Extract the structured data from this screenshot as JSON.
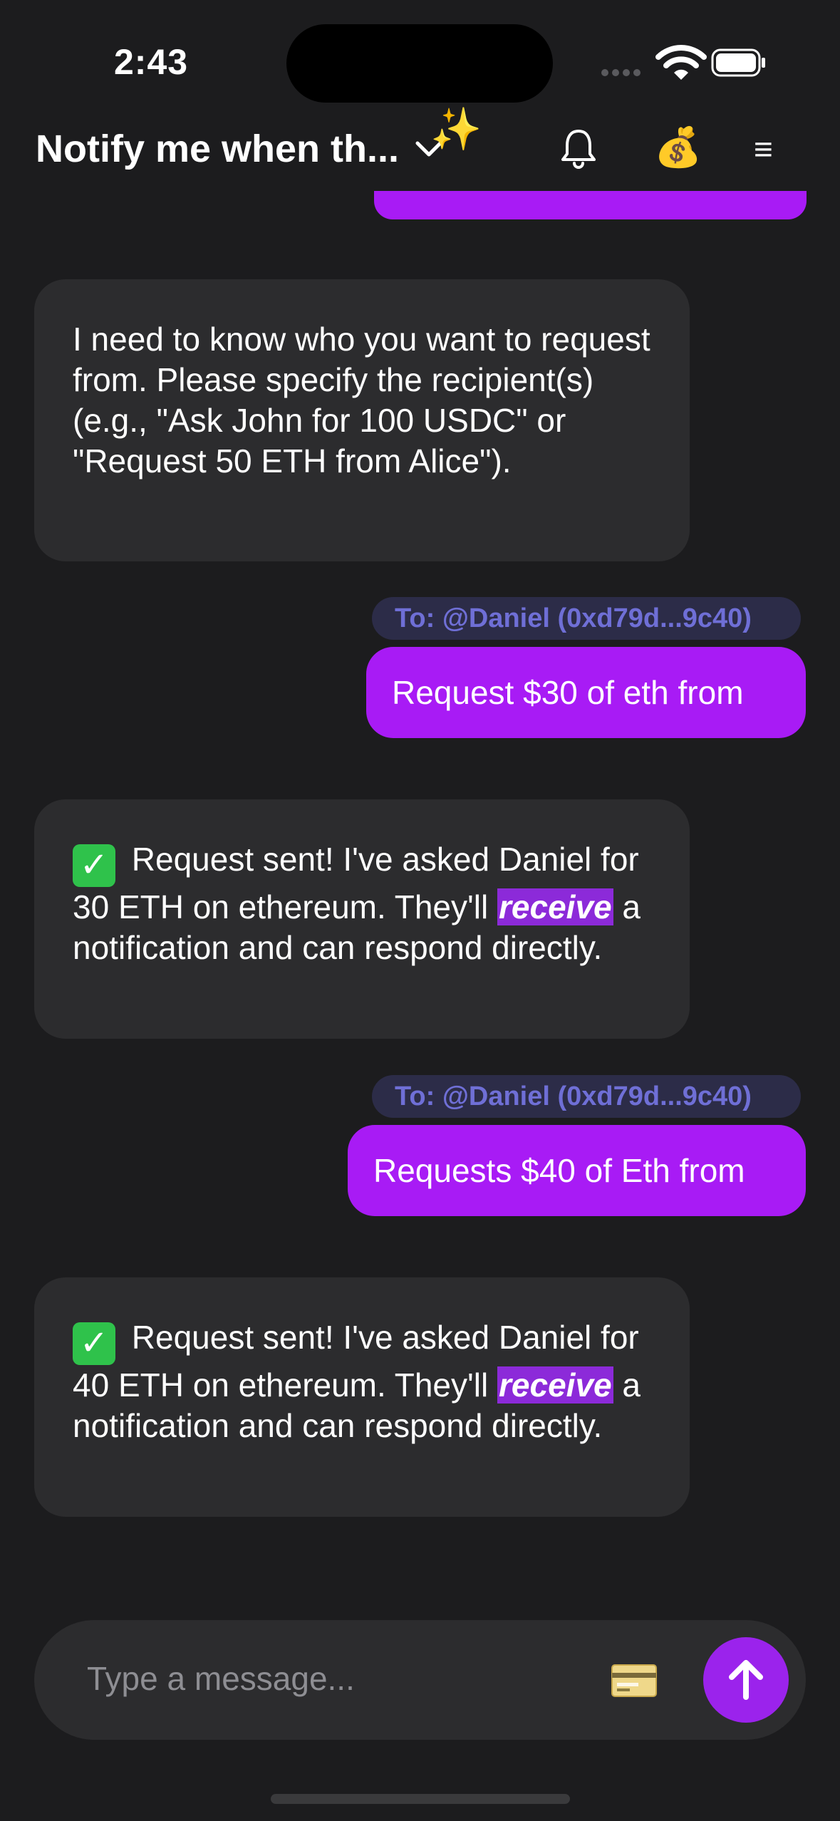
{
  "status_bar": {
    "time": "2:43"
  },
  "header": {
    "title": "Notify me when th...",
    "sparkle": "✨",
    "wallet_emoji": "💰",
    "menu_glyph": "≡",
    "icons": [
      "chevron-down-icon",
      "sparkle-icon",
      "bell-icon",
      "money-bag-icon",
      "menu-icon"
    ]
  },
  "messages": [
    {
      "role": "assistant",
      "text": "I need to know who you want to request from. Please specify the recipient(s) (e.g., \"Ask John for 100 USDC\" or \"Request 50 ETH from Alice\")."
    },
    {
      "role": "user",
      "to": "To: @Daniel (0xd79d...9c40)",
      "text": "Request $30 of eth from"
    },
    {
      "role": "assistant",
      "check": "✓",
      "part1": "Request sent! I've asked Daniel for 30 ETH on ethereum. They'll",
      "highlight": "receive",
      "part2": "a notification and can respond directly."
    },
    {
      "role": "user",
      "to": "To: @Daniel (0xd79d...9c40)",
      "text": "Requests $40 of Eth from"
    },
    {
      "role": "assistant",
      "check": "✓",
      "part1": "Request sent! I've asked Daniel for 40 ETH on ethereum. They'll",
      "highlight": "receive",
      "part2": "a notification and can respond directly."
    }
  ],
  "composer": {
    "placeholder": "Type a message...",
    "icons": [
      "credit-card-icon",
      "arrow-up-icon"
    ]
  },
  "colors": {
    "background": "#1c1c1e",
    "bubble_assistant": "#2c2c2e",
    "bubble_user": "#a81bf5",
    "to_pill_bg": "#2c2c48",
    "to_pill_text": "#6f6fd6",
    "highlight": "#8c2ad9",
    "send_button": "#9b23ec"
  }
}
